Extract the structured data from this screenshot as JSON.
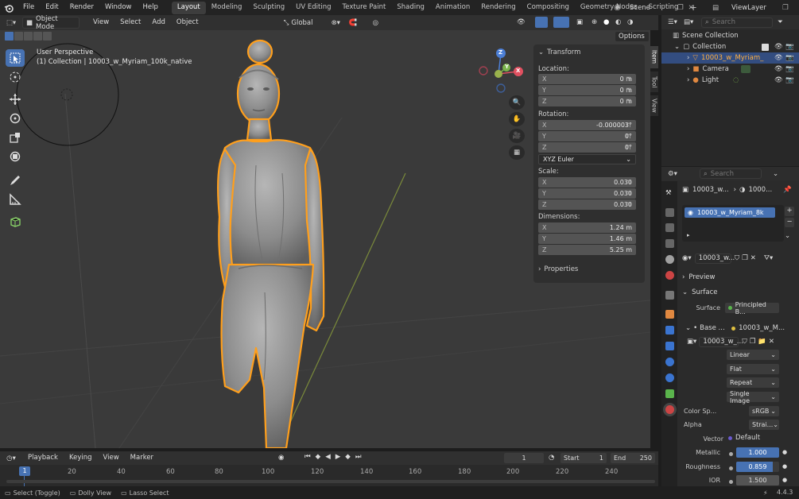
{
  "topbar": {
    "menus": [
      "File",
      "Edit",
      "Render",
      "Window",
      "Help"
    ],
    "workspaces": [
      "Layout",
      "Modeling",
      "Sculpting",
      "UV Editing",
      "Texture Paint",
      "Shading",
      "Animation",
      "Rendering",
      "Compositing",
      "Geometry Nodes",
      "Scripting"
    ],
    "active_workspace": "Layout",
    "scene": "Scene",
    "view_layer": "ViewLayer"
  },
  "viewport_header": {
    "mode": "Object Mode",
    "menus": [
      "View",
      "Select",
      "Add",
      "Object"
    ],
    "transform_orientation": "Global",
    "options": "Options"
  },
  "viewport": {
    "perspective_label": "User Perspective",
    "collection_label": "(1) Collection | 10003_w_Myriam_100k_native",
    "gizmo": {
      "x": "X",
      "y": "Y",
      "z": "Z"
    }
  },
  "npanel": {
    "transform_title": "Transform",
    "location_label": "Location:",
    "location": [
      {
        "axis": "X",
        "value": "0 m"
      },
      {
        "axis": "Y",
        "value": "0 m"
      },
      {
        "axis": "Z",
        "value": "0 m"
      }
    ],
    "rotation_label": "Rotation:",
    "rotation": [
      {
        "axis": "X",
        "value": "-0.000003°"
      },
      {
        "axis": "Y",
        "value": "0°"
      },
      {
        "axis": "Z",
        "value": "0°"
      }
    ],
    "rotation_mode": "XYZ Euler",
    "scale_label": "Scale:",
    "scale": [
      {
        "axis": "X",
        "value": "0.030"
      },
      {
        "axis": "Y",
        "value": "0.030"
      },
      {
        "axis": "Z",
        "value": "0.030"
      }
    ],
    "dimensions_label": "Dimensions:",
    "dimensions": [
      {
        "axis": "X",
        "value": "1.24 m"
      },
      {
        "axis": "Y",
        "value": "1.46 m"
      },
      {
        "axis": "Z",
        "value": "5.25 m"
      }
    ],
    "properties_title": "Properties",
    "tabs": [
      "Item",
      "Tool",
      "View"
    ]
  },
  "timeline": {
    "menus": [
      "Playback",
      "Keying",
      "View",
      "Marker"
    ],
    "current_frame": "1",
    "start_label": "Start",
    "start": "1",
    "end_label": "End",
    "end": "250",
    "ruler": [
      "1",
      "20",
      "40",
      "60",
      "80",
      "100",
      "120",
      "140",
      "160",
      "180",
      "200",
      "220",
      "240"
    ]
  },
  "statusbar": {
    "hints": [
      "Select (Toggle)",
      "Dolly View",
      "Lasso Select"
    ],
    "version": "4.4.3"
  },
  "outliner": {
    "search_placeholder": "Search",
    "items": [
      {
        "label": "Scene Collection"
      },
      {
        "label": "Collection"
      },
      {
        "label": "10003_w_Myriam_"
      },
      {
        "label": "Camera"
      },
      {
        "label": "Light"
      }
    ]
  },
  "properties": {
    "search_placeholder": "Search",
    "breadcrumb_object": "10003_w...",
    "breadcrumb_material": "1000...",
    "material_slot": "10003_w_Myriam_8k",
    "material_name": "10003_w...",
    "preview_label": "Preview",
    "surface_section": "Surface",
    "surface_label": "Surface",
    "surface_value": "Principled B...",
    "base_label": "Base ...",
    "base_value": "10003_w_M...",
    "image_name": "10003_w_...",
    "interpolation": "Linear",
    "projection": "Flat",
    "extension": "Repeat",
    "source": "Single Image",
    "color_space_label": "Color Sp...",
    "color_space": "sRGB",
    "alpha_label": "Alpha",
    "alpha": "Strai...",
    "vector_label": "Vector",
    "vector": "Default",
    "metallic_label": "Metallic",
    "metallic": "1.000",
    "roughness_label": "Roughness",
    "roughness": "0.859",
    "roughness_fill": 0.859,
    "ior_label": "IOR",
    "ior": "1.500"
  },
  "colors": {
    "accent": "#4772b3",
    "selection": "#ff9f1c",
    "x_axis": "#e05060",
    "y_axis": "#7ab44c",
    "z_axis": "#4c7fd6"
  }
}
